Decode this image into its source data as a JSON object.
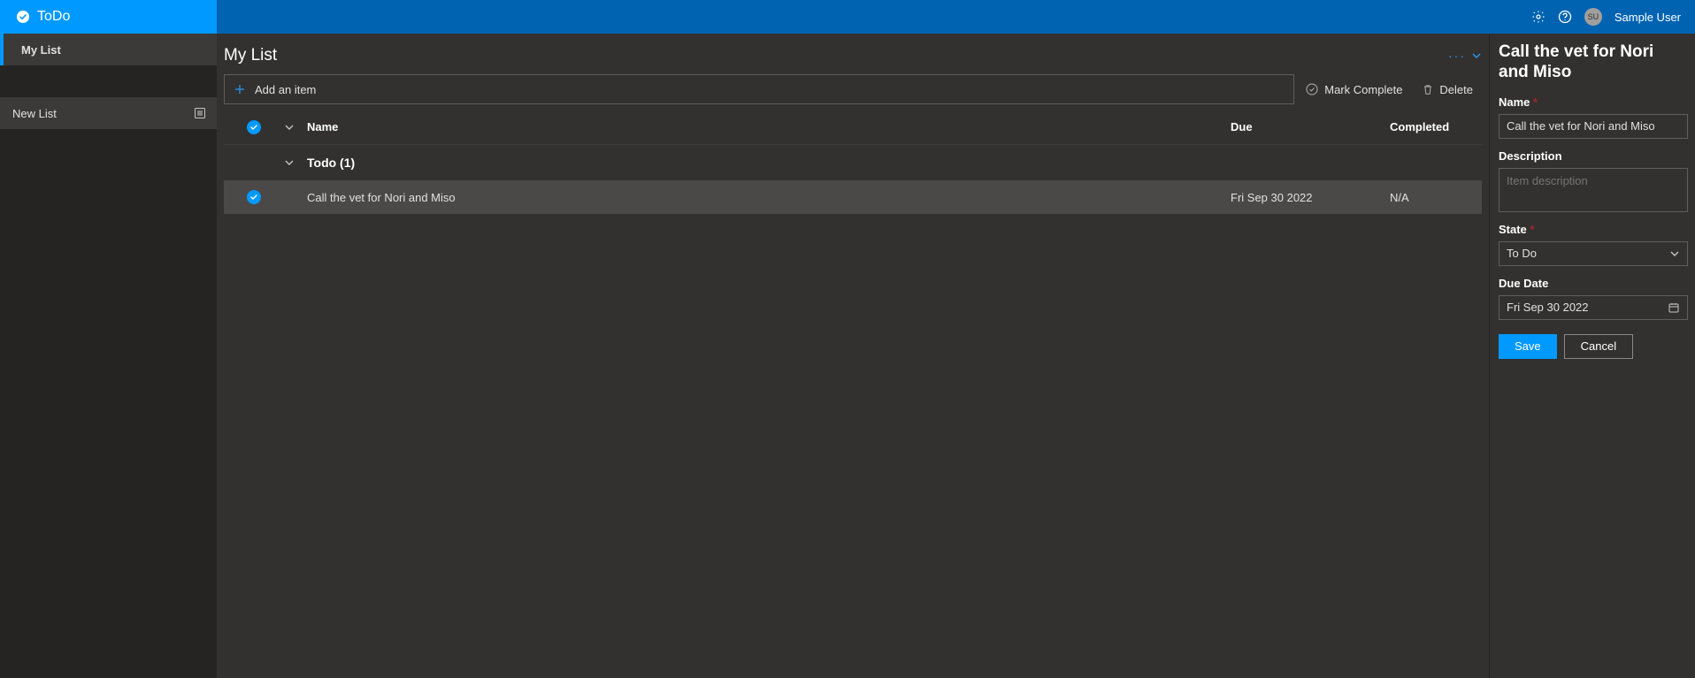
{
  "header": {
    "brand": "ToDo",
    "user_name": "Sample User",
    "user_initials": "SU"
  },
  "sidebar": {
    "items": [
      {
        "label": "My List"
      }
    ],
    "new_list_label": "New List"
  },
  "main": {
    "title": "My List",
    "add_item_placeholder": "Add an item",
    "actions": {
      "mark_complete": "Mark Complete",
      "delete": "Delete"
    },
    "columns": {
      "name": "Name",
      "due": "Due",
      "completed": "Completed"
    },
    "group": {
      "label": "Todo (1)"
    },
    "tasks": [
      {
        "name": "Call the vet for Nori and Miso",
        "due": "Fri Sep 30 2022",
        "completed": "N/A"
      }
    ]
  },
  "detail": {
    "title": "Call the vet for Nori and Miso",
    "labels": {
      "name": "Name",
      "description": "Description",
      "state": "State",
      "due_date": "Due Date"
    },
    "fields": {
      "name_value": "Call the vet for Nori and Miso",
      "description_placeholder": "Item description",
      "state_value": "To Do",
      "due_date_value": "Fri Sep 30 2022"
    },
    "buttons": {
      "save": "Save",
      "cancel": "Cancel"
    }
  }
}
